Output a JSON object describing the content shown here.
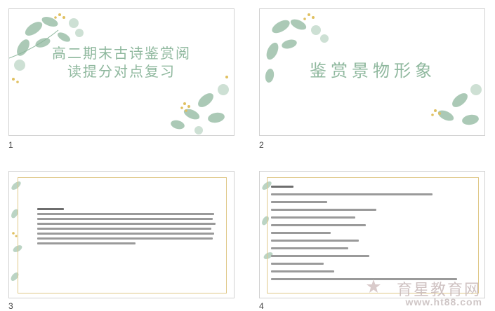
{
  "slides": [
    {
      "number": "1",
      "title_line1": "高二期末古诗鉴赏阅",
      "title_line2": "读提分对点复习"
    },
    {
      "number": "2",
      "title": "鉴赏景物形象"
    },
    {
      "number": "3"
    },
    {
      "number": "4"
    }
  ],
  "colors": {
    "leaf_green": "#8fb89e",
    "leaf_gold": "#e0c060",
    "frame_gold": "#e0c98a",
    "title_green": "#8fb89e"
  },
  "watermark": {
    "text": "育星教育网",
    "url": "www.ht88.com"
  }
}
